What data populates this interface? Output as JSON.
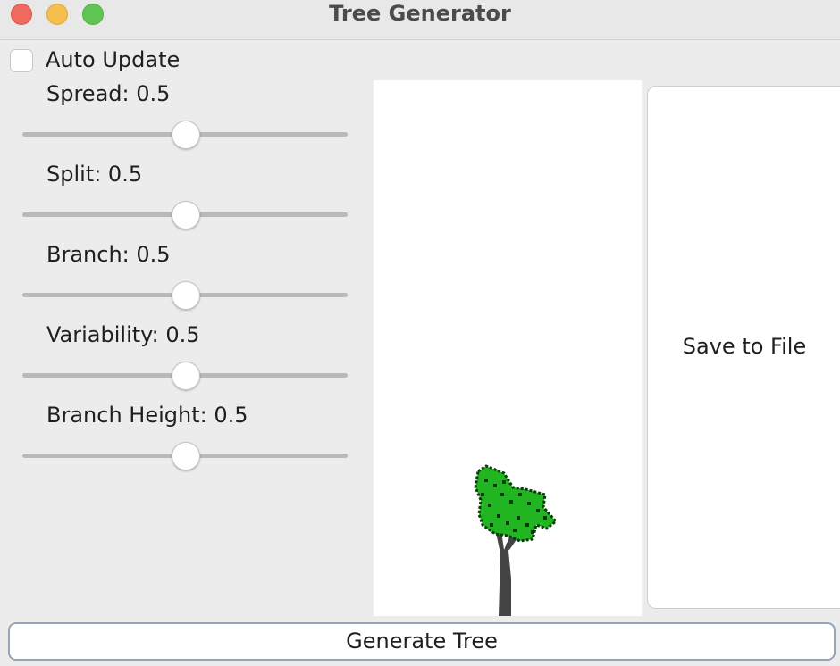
{
  "window": {
    "title": "Tree Generator"
  },
  "auto_update": {
    "label": "Auto Update",
    "checked": false
  },
  "sliders": [
    {
      "label": "Spread: 0.5",
      "value": 0.5
    },
    {
      "label": "Split: 0.5",
      "value": 0.5
    },
    {
      "label": "Branch: 0.5",
      "value": 0.5
    },
    {
      "label": "Variability: 0.5",
      "value": 0.5
    },
    {
      "label": "Branch Height: 0.5",
      "value": 0.5
    }
  ],
  "buttons": {
    "save": "Save to File",
    "generate": "Generate Tree"
  },
  "colors": {
    "trunk": "#444444",
    "foliage": "#22b522",
    "foliage_dark": "#0a3a0a"
  }
}
